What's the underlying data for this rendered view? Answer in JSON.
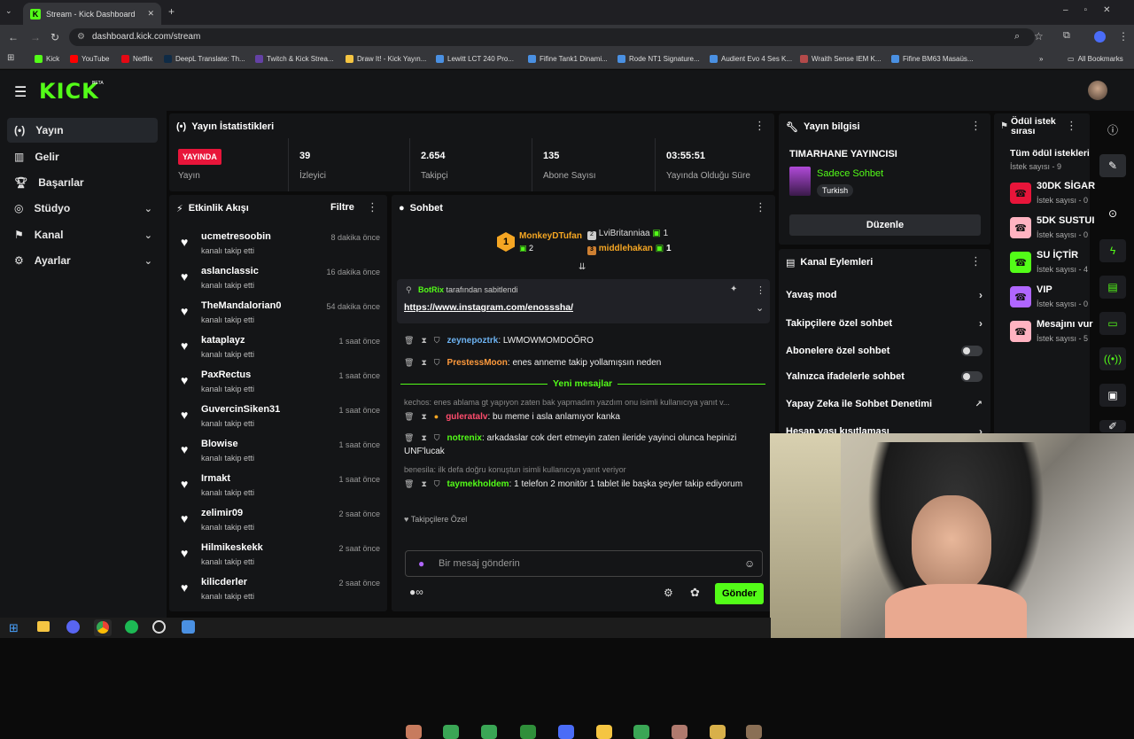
{
  "browser": {
    "tab_title": "Stream - Kick Dashboard",
    "url": "dashboard.kick.com/stream",
    "bookmarks": [
      "Kick",
      "YouTube",
      "Netflix",
      "DeepL Translate: Th...",
      "Twitch & Kick Strea...",
      "Draw It! - Kick Yayın...",
      "Lewitt LCT 240 Pro...",
      "Fifine Tank1 Dinami...",
      "Rode NT1 Signature...",
      "Audient Evo 4 Ses K...",
      "Wraith Sense IEM K...",
      "Fifine BM63 Masaüs..."
    ],
    "all_bookmarks": "All Bookmarks"
  },
  "header": {
    "logo": "KICK",
    "beta": "BETA"
  },
  "sidebar": {
    "items": [
      {
        "label": "Yayın",
        "icon": "broadcast-icon"
      },
      {
        "label": "Gelir",
        "icon": "chart-icon"
      },
      {
        "label": "Başarılar",
        "icon": "trophy-icon"
      },
      {
        "label": "Stüdyo",
        "icon": "studio-icon"
      },
      {
        "label": "Kanal",
        "icon": "channel-icon"
      },
      {
        "label": "Ayarlar",
        "icon": "gear-icon"
      }
    ]
  },
  "stats": {
    "title": "Yayın İstatistikleri",
    "live_badge": "YAYINDA",
    "items": [
      {
        "value": "",
        "label": "Yayın"
      },
      {
        "value": "39",
        "label": "İzleyici"
      },
      {
        "value": "2.654",
        "label": "Takipçi"
      },
      {
        "value": "135",
        "label": "Abone Sayısı"
      },
      {
        "value": "03:55:51",
        "label": "Yayında Olduğu Süre"
      }
    ]
  },
  "activity": {
    "title": "Etkinlik Akışı",
    "filter": "Filtre",
    "events": [
      {
        "name": "ucmetresoobin",
        "sub": "kanalı takip etti",
        "time": "8 dakika önce"
      },
      {
        "name": "aslanclassic",
        "sub": "kanalı takip etti",
        "time": "16 dakika önce"
      },
      {
        "name": "TheMandalorian0",
        "sub": "kanalı takip etti",
        "time": "54 dakika önce"
      },
      {
        "name": "kataplayz",
        "sub": "kanalı takip etti",
        "time": "1 saat önce"
      },
      {
        "name": "PaxRectus",
        "sub": "kanalı takip etti",
        "time": "1 saat önce"
      },
      {
        "name": "GuvercinSiken31",
        "sub": "kanalı takip etti",
        "time": "1 saat önce"
      },
      {
        "name": "Blowise",
        "sub": "kanalı takip etti",
        "time": "1 saat önce"
      },
      {
        "name": "Irmakt",
        "sub": "kanalı takip etti",
        "time": "1 saat önce"
      },
      {
        "name": "zelimir09",
        "sub": "kanalı takip etti",
        "time": "2 saat önce"
      },
      {
        "name": "Hilmikeskekk",
        "sub": "kanalı takip etti",
        "time": "2 saat önce"
      },
      {
        "name": "kilicderler",
        "sub": "kanalı takip etti",
        "time": "2 saat önce"
      }
    ]
  },
  "chat": {
    "title": "Sohbet",
    "leaders": {
      "first": {
        "rank": "1",
        "name": "MonkeyDTufan",
        "count": "2"
      },
      "second": {
        "rank": "2",
        "name": "LviBritanniaa",
        "count": "1"
      },
      "third": {
        "rank": "3",
        "name": "middlehakan",
        "count": "1"
      }
    },
    "pinned": {
      "by": "BotRix",
      "text": "tarafından sabitlendi",
      "link": "https://www.instagram.com/enosssha/"
    },
    "messages": [
      {
        "user": "zeynepoztrk",
        "text": ": LWMOWMOMDOÕRO",
        "color": "#6db3f2"
      },
      {
        "user": "PrestessMoon",
        "text": ": enes anneme takip yollamışsın neden",
        "color": "#ff9a3c"
      }
    ],
    "new_messages": "Yeni mesajlar",
    "reply1": "kechos: enes ablama gt yapıyon zaten bak yapmadım yazdım onu isimli kullanıcıya yanıt v...",
    "msg3": {
      "user": "guleratalv",
      "text": ": bu meme i asla anlamıyor kanka",
      "color": "#ff4d6d"
    },
    "msg4": {
      "user": "notrenix",
      "text": ": arkadaslar cok dert etmeyin zaten ileride yayinci olunca hepinizi UNF'lucak",
      "color": "#53fc18"
    },
    "reply2": "benesila: ilk defa doğru konuştun isimli kullanıcıya yanıt veriyor",
    "msg5": {
      "user": "taymekholdem",
      "text": ": 1 telefon 2 monitör 1 tablet ile başka şeyler takip ediyorum",
      "color": "#53fc18"
    },
    "followers_only": "Takipçilere Özel",
    "input_placeholder": "Bir mesaj gönderin",
    "send": "Gönder"
  },
  "stream_info": {
    "title": "Yayın bilgisi",
    "stream_title": "TIMARHANE YAYINCISI",
    "category": "Sadece Sohbet",
    "language": "Turkish",
    "edit": "Düzenle"
  },
  "channel_actions": {
    "title": "Kanal Eylemleri",
    "rows": [
      "Yavaş mod",
      "Takipçilere özel sohbet",
      "Abonelere özel sohbet",
      "Yalnızca ifadelerle sohbet",
      "Yapay Zeka ile Sohbet Denetimi",
      "Hesap yaşı kısıtlaması"
    ]
  },
  "rewards": {
    "title": "Ödül istek sırası",
    "all": "Tüm ödül istekleri",
    "all_count": "İstek sayısı - 9",
    "items": [
      {
        "name": "30DK SİGAR",
        "count": "İstek sayısı - 0",
        "color": "#e8153a"
      },
      {
        "name": "5DK SUSTUI",
        "count": "İstek sayısı - 0",
        "color": "#ffb3c1"
      },
      {
        "name": "SU İÇTİR",
        "count": "İstek sayısı - 4",
        "color": "#53fc18"
      },
      {
        "name": "VIP",
        "count": "İstek sayısı - 0",
        "color": "#b066ff"
      },
      {
        "name": "Mesajını vur",
        "count": "İstek sayısı - 5",
        "color": "#ffb3c1"
      }
    ]
  }
}
